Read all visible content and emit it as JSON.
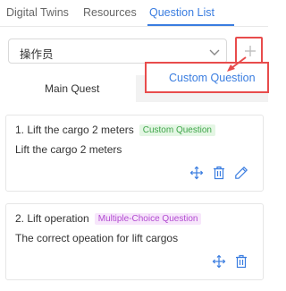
{
  "tabs": [
    {
      "label": "Digital Twins"
    },
    {
      "label": "Resources"
    },
    {
      "label": "Question List"
    }
  ],
  "role_select": {
    "value": "操作员"
  },
  "add_button": {
    "icon": "plus-icon"
  },
  "subtabs": {
    "main": "Main Quest",
    "custom": "Custom Question"
  },
  "questions": [
    {
      "title": "1. Lift the cargo 2 meters",
      "badge": "Custom Question",
      "description": "Lift the cargo 2 meters",
      "actions": [
        "move-icon",
        "trash-icon",
        "edit-icon"
      ]
    },
    {
      "title": "2. Lift operation",
      "badge": "Multiple-Choice Question",
      "description": "The correct opeation for lift cargos",
      "actions": [
        "move-icon",
        "trash-icon"
      ]
    }
  ],
  "colors": {
    "accent": "#3a7de0",
    "highlight": "#e84c4c",
    "custom_badge": "#3fa64a",
    "mc_badge": "#b24ad1"
  }
}
